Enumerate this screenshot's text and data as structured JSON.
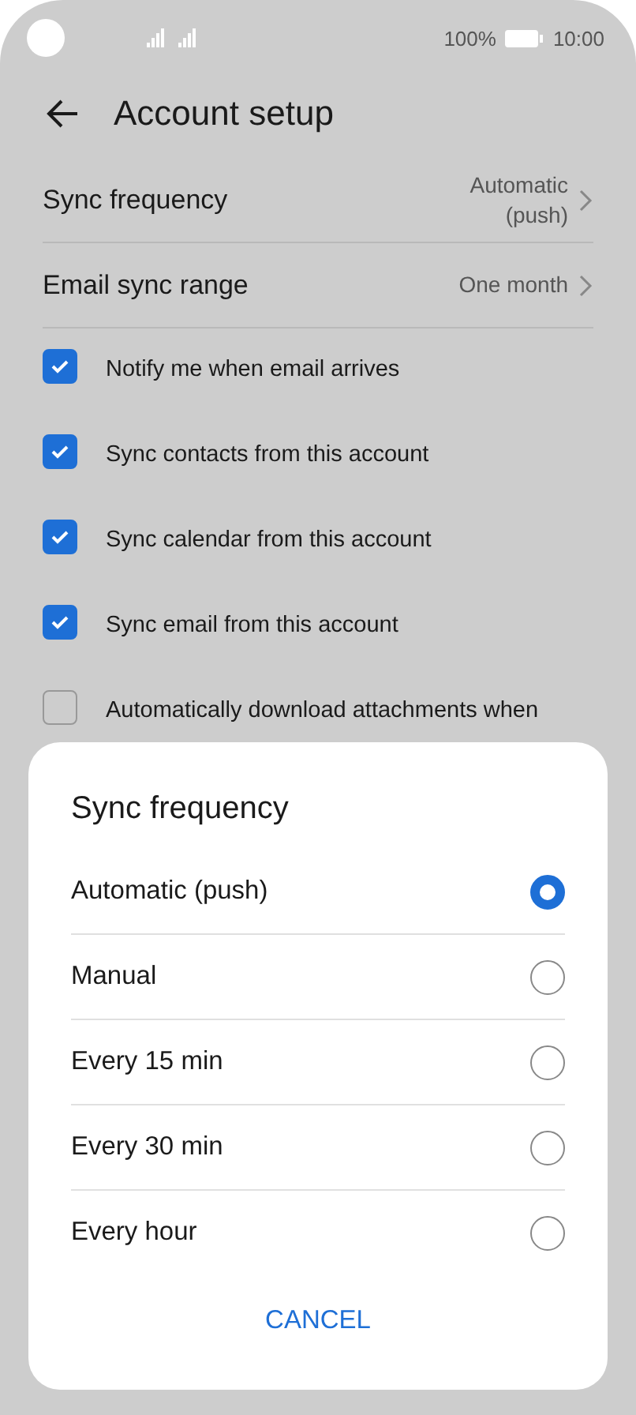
{
  "status_bar": {
    "battery": "100%",
    "time": "10:00"
  },
  "header": {
    "title": "Account setup"
  },
  "settings": [
    {
      "label": "Sync frequency",
      "value": "Automatic\n(push)"
    },
    {
      "label": "Email sync range",
      "value": "One month"
    }
  ],
  "checkboxes": [
    {
      "label": "Notify me when email arrives",
      "checked": true
    },
    {
      "label": "Sync contacts from this account",
      "checked": true
    },
    {
      "label": "Sync calendar from this account",
      "checked": true
    },
    {
      "label": "Sync email from this account",
      "checked": true
    },
    {
      "label": "Automatically download attachments when",
      "checked": false
    }
  ],
  "dialog": {
    "title": "Sync frequency",
    "options": [
      {
        "label": "Automatic (push)",
        "selected": true
      },
      {
        "label": "Manual",
        "selected": false
      },
      {
        "label": "Every 15 min",
        "selected": false
      },
      {
        "label": "Every 30 min",
        "selected": false
      },
      {
        "label": "Every hour",
        "selected": false
      }
    ],
    "cancel": "CANCEL"
  }
}
